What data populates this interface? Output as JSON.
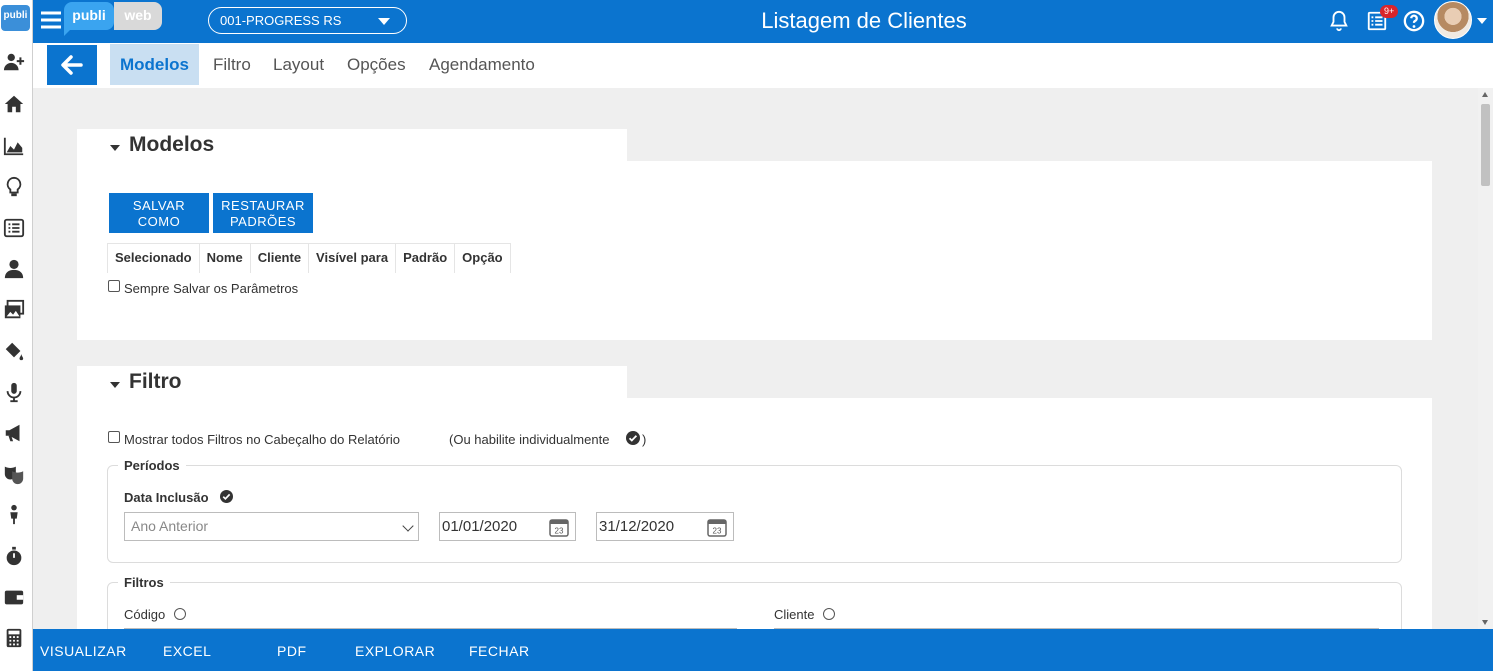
{
  "app": {
    "brand_left": "publi",
    "brand_right": "web",
    "side_logo": "publi",
    "company": "001-PROGRESS RS",
    "title": "Listagem de Clientes",
    "notification_badge": "9+"
  },
  "sidebar": {
    "icons": [
      "add-user-icon",
      "home-icon",
      "area-chart-icon",
      "lightbulb-icon",
      "list-icon",
      "user-tie-icon",
      "images-icon",
      "paint-bucket-icon",
      "microphone-icon",
      "megaphone-icon",
      "theater-masks-icon",
      "person-icon",
      "stopwatch-icon",
      "wallet-icon",
      "calculator-icon"
    ]
  },
  "subnav": {
    "tabs": [
      {
        "label": "Modelos",
        "active": true
      },
      {
        "label": "Filtro",
        "active": false
      },
      {
        "label": "Layout",
        "active": false
      },
      {
        "label": "Opções",
        "active": false
      },
      {
        "label": "Agendamento",
        "active": false
      }
    ]
  },
  "modelos": {
    "title": "Modelos",
    "save_as_line1": "SALVAR",
    "save_as_line2": "COMO",
    "restore_line1": "RESTAURAR",
    "restore_line2": "PADRÕES",
    "columns": [
      "Selecionado",
      "Nome",
      "Cliente",
      "Visível para",
      "Padrão",
      "Opção"
    ],
    "always_save_label": "Sempre Salvar os Parâmetros"
  },
  "filtro": {
    "title": "Filtro",
    "show_all_label": "Mostrar todos Filtros no Cabeçalho do Relatório",
    "individual_hint": "(Ou habilite individualmente",
    "individual_hint_close": ")",
    "periodos_legend": "Períodos",
    "data_inclusao_label": "Data Inclusão",
    "period_select": "Ano Anterior",
    "date_from": "01/01/2020",
    "date_to": "31/12/2020",
    "calendar_day": "23",
    "filtros_legend": "Filtros",
    "codigo_label": "Código",
    "cliente_label": "Cliente"
  },
  "bottombar": {
    "visualizar": "VISUALIZAR",
    "excel": "EXCEL",
    "pdf": "PDF",
    "explorar": "EXPLORAR",
    "fechar": "FECHAR"
  },
  "colors": {
    "primary": "#0b74cf",
    "active_tab_bg": "#c9dff2",
    "badge": "#d9252b"
  }
}
